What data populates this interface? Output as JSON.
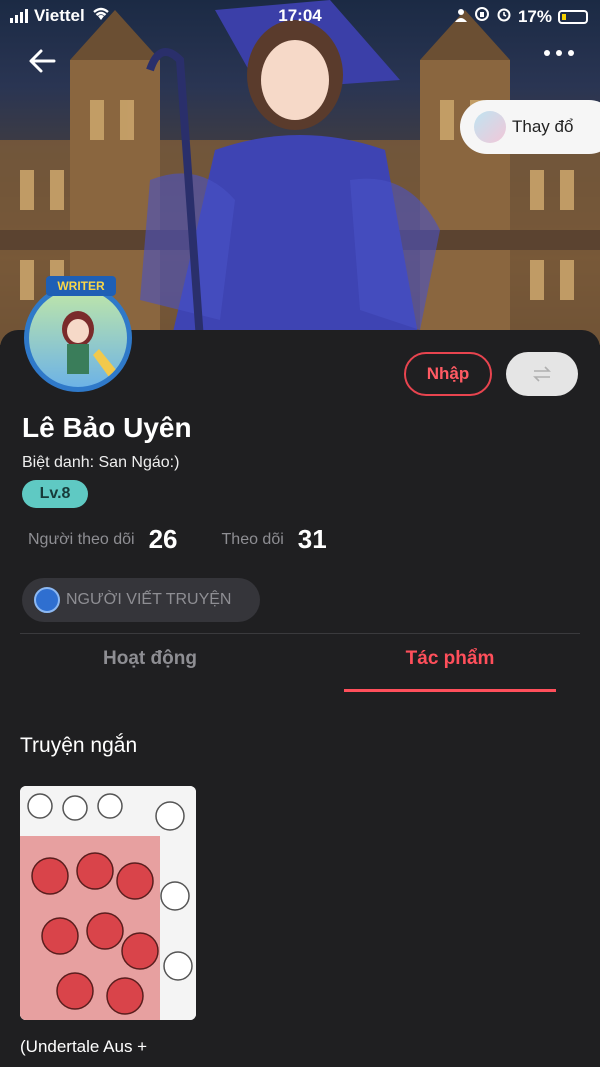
{
  "status_bar": {
    "carrier": "Viettel",
    "time": "17:04",
    "battery": "17%"
  },
  "cover": {
    "change_button_label": "Thay đổ"
  },
  "profile": {
    "avatar_badge": "WRITER",
    "name": "Lê Bảo Uyên",
    "nickname": "Biệt danh: San Ngáo:)",
    "level": "Lv.8",
    "join_button": "Nhập",
    "stats": {
      "followers_label": "Người theo dõi",
      "followers_value": "26",
      "following_label": "Theo dõi",
      "following_value": "31"
    },
    "role_chip": "NGƯỜI VIẾT TRUYỆN"
  },
  "tabs": [
    {
      "label": "Hoạt động",
      "active": false
    },
    {
      "label": "Tác phẩm",
      "active": true
    }
  ],
  "section": {
    "title": "Truyện ngắn",
    "stories": [
      {
        "title": "(Undertale Aus +"
      }
    ]
  },
  "colors": {
    "accent": "#ff4f5b",
    "level_bg": "#5fc9c3",
    "background": "#1f1f21"
  }
}
